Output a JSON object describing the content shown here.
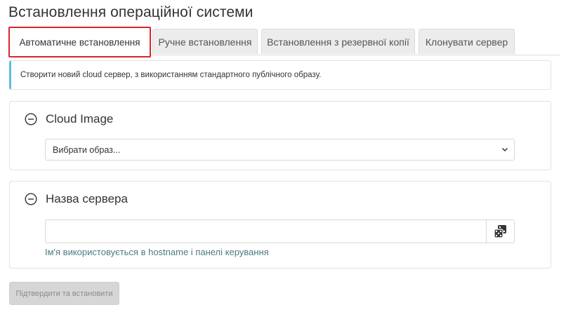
{
  "page": {
    "title": "Встановлення операційної системи"
  },
  "tabs": [
    {
      "label": "Автоматичне встановлення",
      "active": true
    },
    {
      "label": "Ручне встановлення",
      "active": false
    },
    {
      "label": "Встановлення з резервної копії",
      "active": false
    },
    {
      "label": "Клонувати сервер",
      "active": false
    }
  ],
  "info": {
    "text": "Створити новий cloud сервер, з використанням стандартного публічного образу."
  },
  "image_panel": {
    "title": "Cloud Image",
    "select_value": "Вибрати образ..."
  },
  "name_panel": {
    "title": "Назва сервера",
    "input_value": "",
    "help_text": "Ім'я використовується в hostname і панелі керування"
  },
  "actions": {
    "submit_label": "Підтвердити та встановити"
  },
  "colors": {
    "active_tab_border": "#d9252e",
    "info_accent": "#5bc0de",
    "help_text": "#4a7b86",
    "disabled_button_bg": "#d6d6d6"
  },
  "icons": {
    "collapse": "minus-circle-icon",
    "select_arrow": "chevron-down-icon",
    "random": "dice-icon"
  }
}
